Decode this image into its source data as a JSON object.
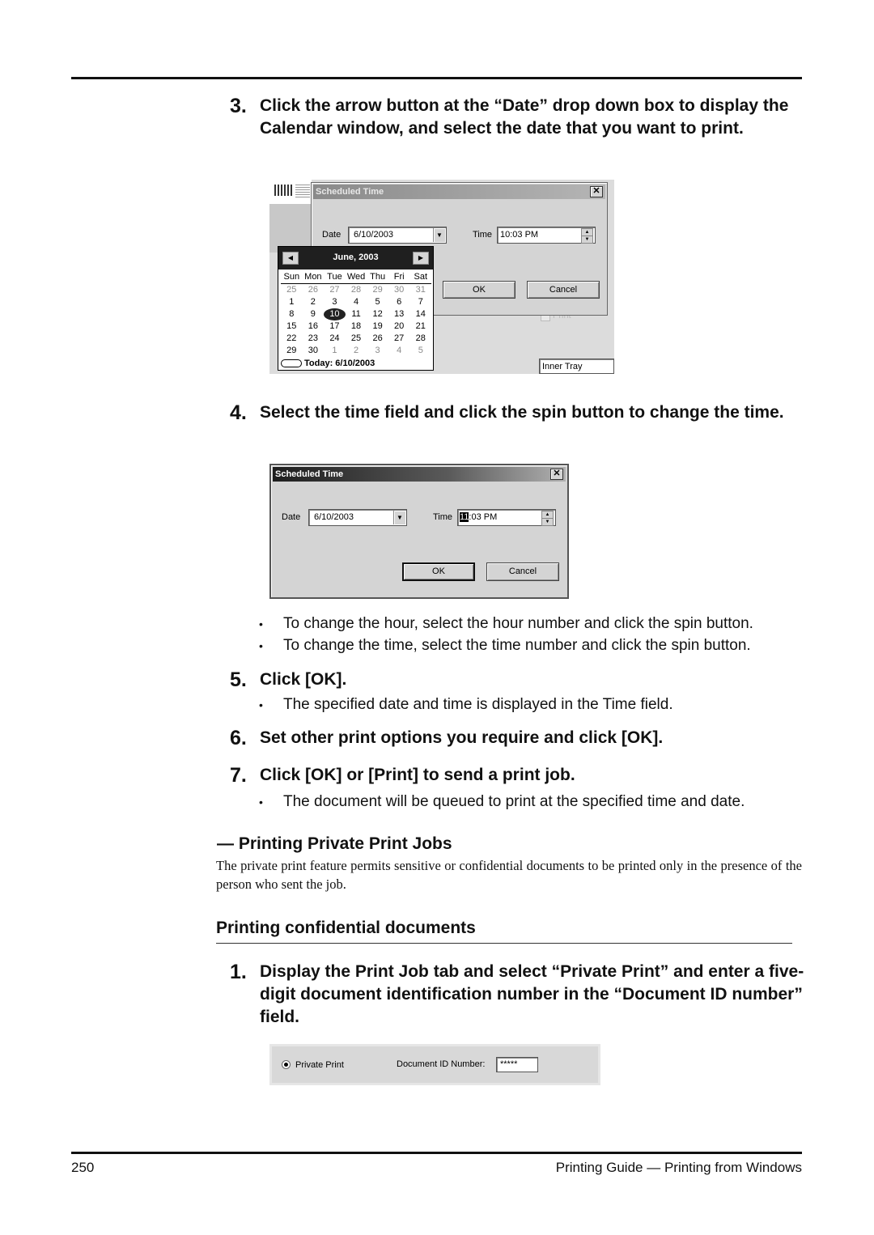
{
  "steps": {
    "s3": {
      "num": "3.",
      "text": "Click the arrow button at the “Date” drop down box to display the Calendar window, and select the date that you want to print."
    },
    "s4": {
      "num": "4.",
      "text": "Select the time field and click the spin button to change the time."
    },
    "s4_bullets": [
      "To change the hour, select the hour number and click the spin button.",
      "To change the time, select the time number and click the spin button."
    ],
    "s5": {
      "num": "5.",
      "text": "Click [OK]."
    },
    "s5_bullets": [
      "The specified date and time is displayed in the Time field."
    ],
    "s6": {
      "num": "6.",
      "text": "Set other print options you require and click [OK]."
    },
    "s7": {
      "num": "7.",
      "text": "Click [OK] or [Print] to send a print job."
    },
    "s7_bullets": [
      "The document will be queued to print at the specified time and date."
    ],
    "c1": {
      "num": "1.",
      "text": "Display the Print Job tab and select “Private Print” and enter a five-digit document identification number in the “Document ID number” field."
    }
  },
  "bullet_char": "•",
  "section": {
    "title": "— Printing Private Print Jobs",
    "body": "The private print feature permits sensitive or confidential documents to be printed only in the presence of the person who sent the job.",
    "subhead": "Printing confidential documents"
  },
  "screenshot1": {
    "dialog_title": "Scheduled Time",
    "close_glyph": "✕",
    "date_label": "Date",
    "date_value": "6/10/2003",
    "time_label": "Time",
    "time_value": "10:03 PM",
    "ok_label": "OK",
    "cancel_label": "Cancel",
    "bg_print_label": "Print",
    "bg_tray_value": "Inner Tray",
    "calendar": {
      "month_label": "June, 2003",
      "prev_glyph": "◀",
      "next_glyph": "▶",
      "dows": [
        "Sun",
        "Mon",
        "Tue",
        "Wed",
        "Thu",
        "Fri",
        "Sat"
      ],
      "weeks": [
        [
          "25",
          "26",
          "27",
          "28",
          "29",
          "30",
          "31"
        ],
        [
          "1",
          "2",
          "3",
          "4",
          "5",
          "6",
          "7"
        ],
        [
          "8",
          "9",
          "10",
          "11",
          "12",
          "13",
          "14"
        ],
        [
          "15",
          "16",
          "17",
          "18",
          "19",
          "20",
          "21"
        ],
        [
          "22",
          "23",
          "24",
          "25",
          "26",
          "27",
          "28"
        ],
        [
          "29",
          "30",
          "1",
          "2",
          "3",
          "4",
          "5"
        ]
      ],
      "selected_day": "10",
      "today_label": "Today: 6/10/2003"
    }
  },
  "screenshot2": {
    "dialog_title": "Scheduled Time",
    "close_glyph": "✕",
    "date_label": "Date",
    "date_value": "6/10/2003",
    "time_label": "Time",
    "time_hour_selected": "11",
    "time_rest": ":03 PM",
    "ok_label": "OK",
    "cancel_label": "Cancel"
  },
  "screenshot3": {
    "radio_label": "Private Print",
    "radio_checked": true,
    "doc_id_label": "Document ID Number:",
    "doc_id_value": "*****"
  },
  "footer": {
    "page_number": "250",
    "guide_title": "Printing Guide — Printing from Windows"
  }
}
